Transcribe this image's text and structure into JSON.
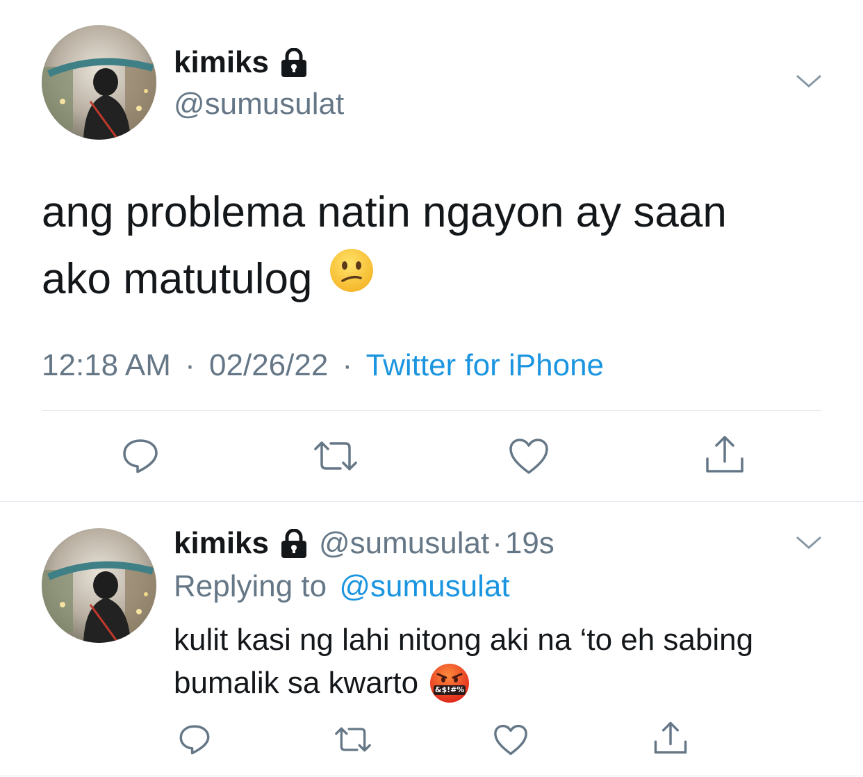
{
  "main_tweet": {
    "author": {
      "display_name": "kimiks",
      "handle": "@sumusulat",
      "avatar": "avatar-photo",
      "protected_icon": "lock-icon"
    },
    "text_line1": "ang problema natin ngayon ay saan",
    "text_line2": "ako matutulog",
    "emoji": "confused-face-emoji",
    "time": "12:18 AM",
    "sep1": "·",
    "date": "02/26/22",
    "sep2": "·",
    "source": "Twitter for iPhone",
    "menu_icon": "chevron-down-icon",
    "actions": [
      "reply-icon",
      "retweet-icon",
      "like-icon",
      "share-icon"
    ]
  },
  "reply_tweet": {
    "author": {
      "display_name": "kimiks",
      "handle": "@sumusulat",
      "avatar": "avatar-photo",
      "protected_icon": "lock-icon"
    },
    "sep": "·",
    "time_ago": "19s",
    "replying_prefix": "Replying to",
    "replying_handle": "@sumusulat",
    "text_line1": "kulit kasi ng lahi nitong aki na ‘to eh sabing",
    "text_line2": "bumalik sa kwarto",
    "emoji": "cursing-face-emoji",
    "emoji_symbols": "&$!#%",
    "menu_icon": "chevron-down-icon",
    "actions": [
      "reply-icon",
      "retweet-icon",
      "like-icon",
      "share-icon"
    ]
  },
  "colors": {
    "text": "#14171a",
    "secondary": "#657786",
    "link": "#1b95e0",
    "divider": "#e1e8ed"
  }
}
